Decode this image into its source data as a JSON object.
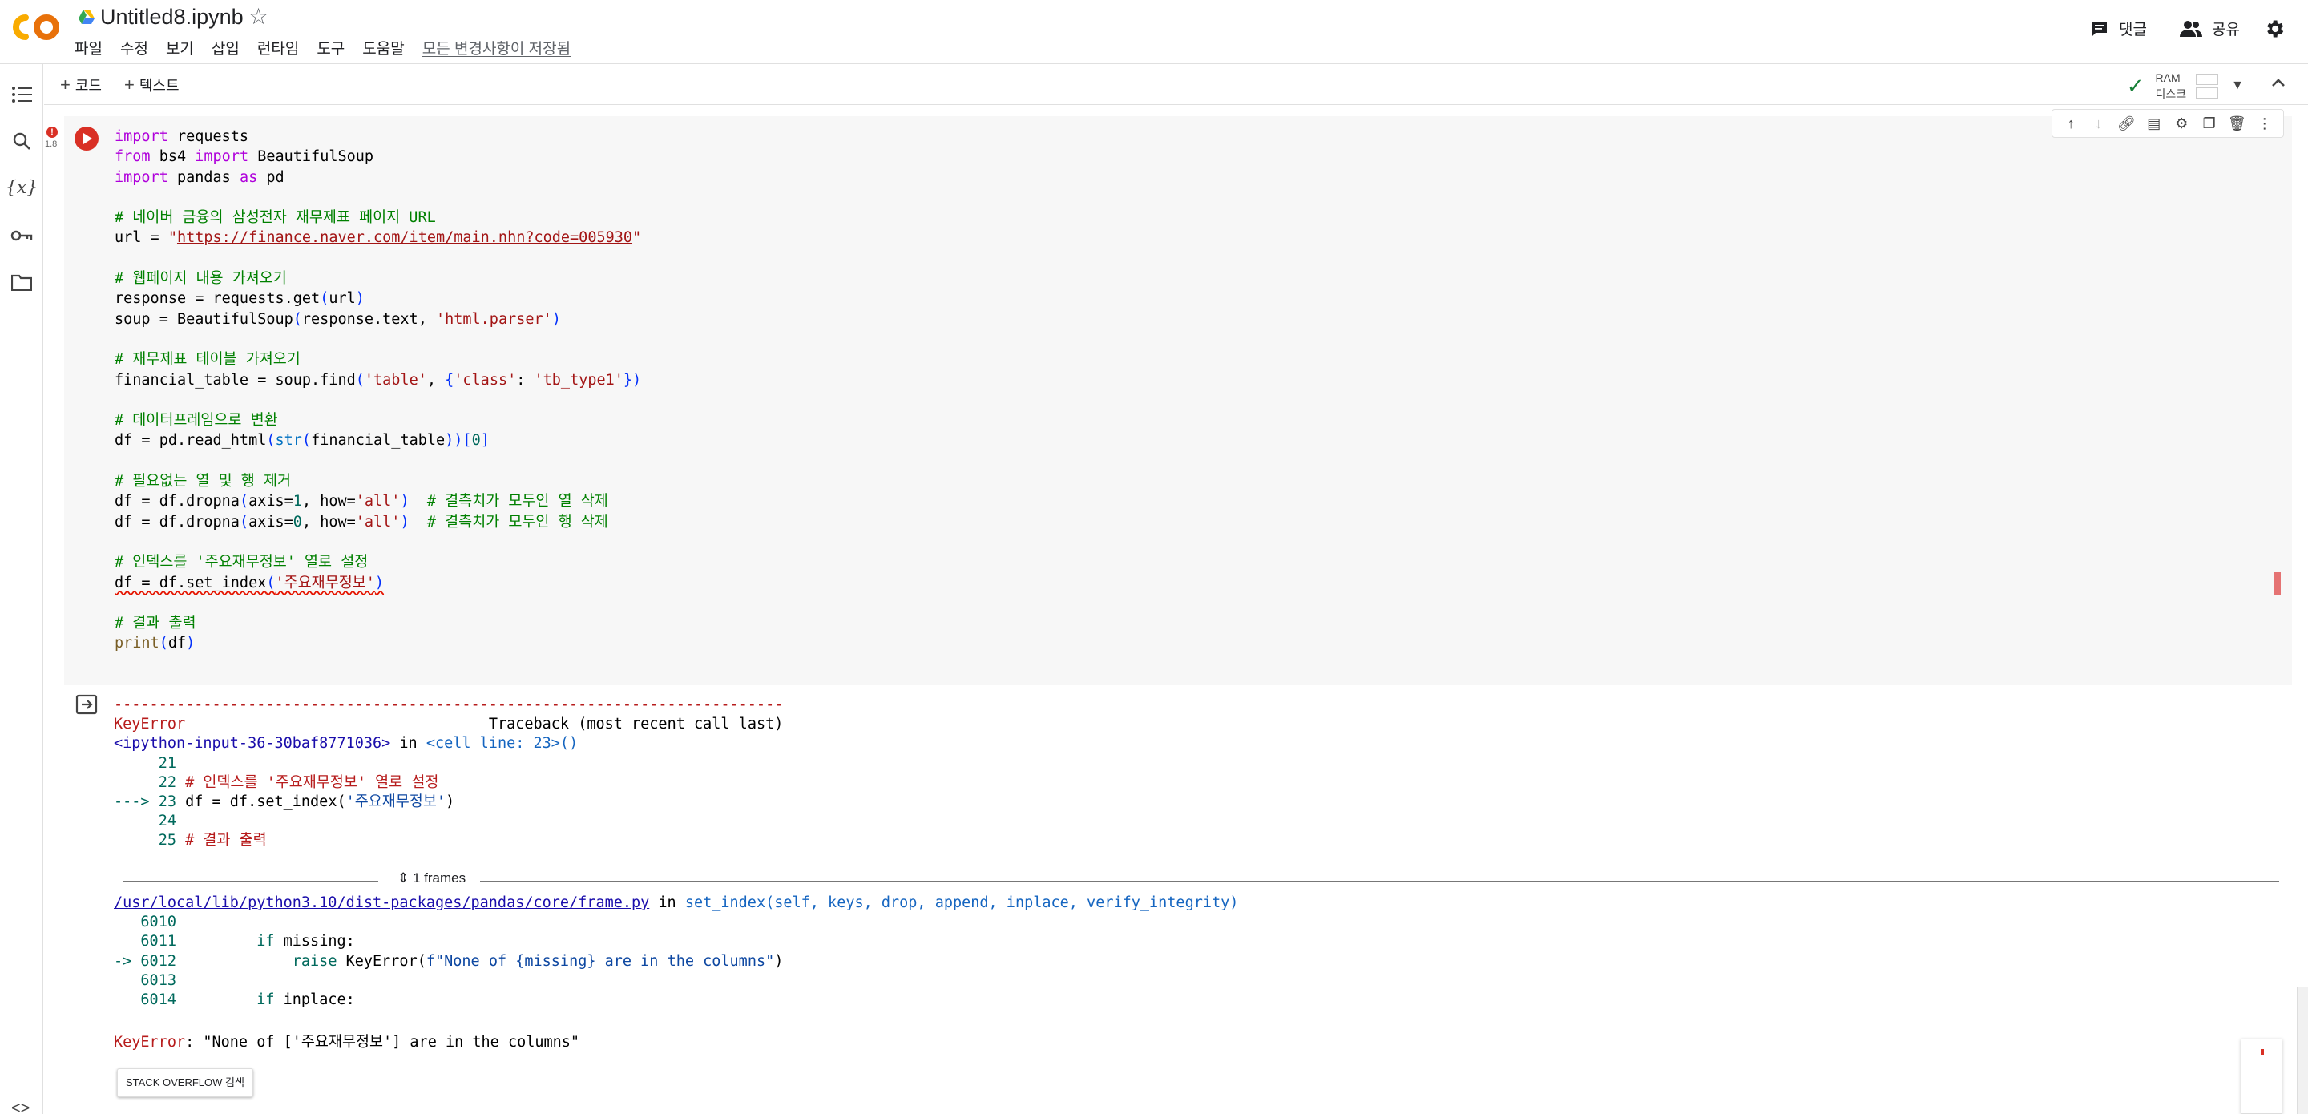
{
  "header": {
    "title": "Untitled8.ipynb",
    "menu": [
      "파일",
      "수정",
      "보기",
      "삽입",
      "런타임",
      "도구",
      "도움말"
    ],
    "save_status": "모든 변경사항이 저장됨",
    "comment_label": "댓글",
    "share_label": "공유"
  },
  "toolbar": {
    "add_code": "코드",
    "add_text": "텍스트",
    "ram_label": "RAM",
    "disk_label": "디스크"
  },
  "cell": {
    "status_badge": "!",
    "exec_count": "1.8",
    "code_lines": [
      "import requests",
      "from bs4 import BeautifulSoup",
      "import pandas as pd",
      "",
      "# 네이버 금융의 삼성전자 재무제표 페이지 URL",
      "url = \"https://finance.naver.com/item/main.nhn?code=005930\"",
      "",
      "# 웹페이지 내용 가져오기",
      "response = requests.get(url)",
      "soup = BeautifulSoup(response.text, 'html.parser')",
      "",
      "# 재무제표 테이블 가져오기",
      "financial_table = soup.find('table', {'class': 'tb_type1'})",
      "",
      "# 데이터프레임으로 변환",
      "df = pd.read_html(str(financial_table))[0]",
      "",
      "# 필요없는 열 및 행 제거",
      "df = df.dropna(axis=1, how='all')  # 결측치가 모두인 열 삭제",
      "df = df.dropna(axis=0, how='all')  # 결측치가 모두인 행 삭제",
      "",
      "# 인덱스를 '주요재무정보' 열로 설정",
      "df = df.set_index('주요재무정보')",
      "",
      "# 결과 출력",
      "print(df)"
    ]
  },
  "output": {
    "dash_line": "---------------------------------------------------------------------------",
    "error_name": "KeyError",
    "traceback_header": "Traceback (most recent call last)",
    "input_link": "<ipython-input-36-30baf8771036>",
    "in_word": "in",
    "cell_line": "<cell line: 23>()",
    "tb_lines": [
      "     21",
      "     22 # 인덱스를 '주요재무정보' 열로 설정",
      "---> 23 df = df.set_index('주요재무정보')",
      "     24",
      "     25 # 결과 출력"
    ],
    "frames_label": "1 frames",
    "frame_path": "/usr/local/lib/python3.10/dist-packages/pandas/core/frame.py",
    "frame_fn": "set_index(self, keys, drop, append, inplace, verify_integrity)",
    "frame_lines": [
      "   6010",
      "   6011         if missing:",
      "-> 6012             raise KeyError(f\"None of {missing} are in the columns\")",
      "   6013",
      "   6014         if inplace:"
    ],
    "final_error_message": ": \"None of ['주요재무정보'] are in the columns\"",
    "so_button": "STACK OVERFLOW 검색"
  }
}
